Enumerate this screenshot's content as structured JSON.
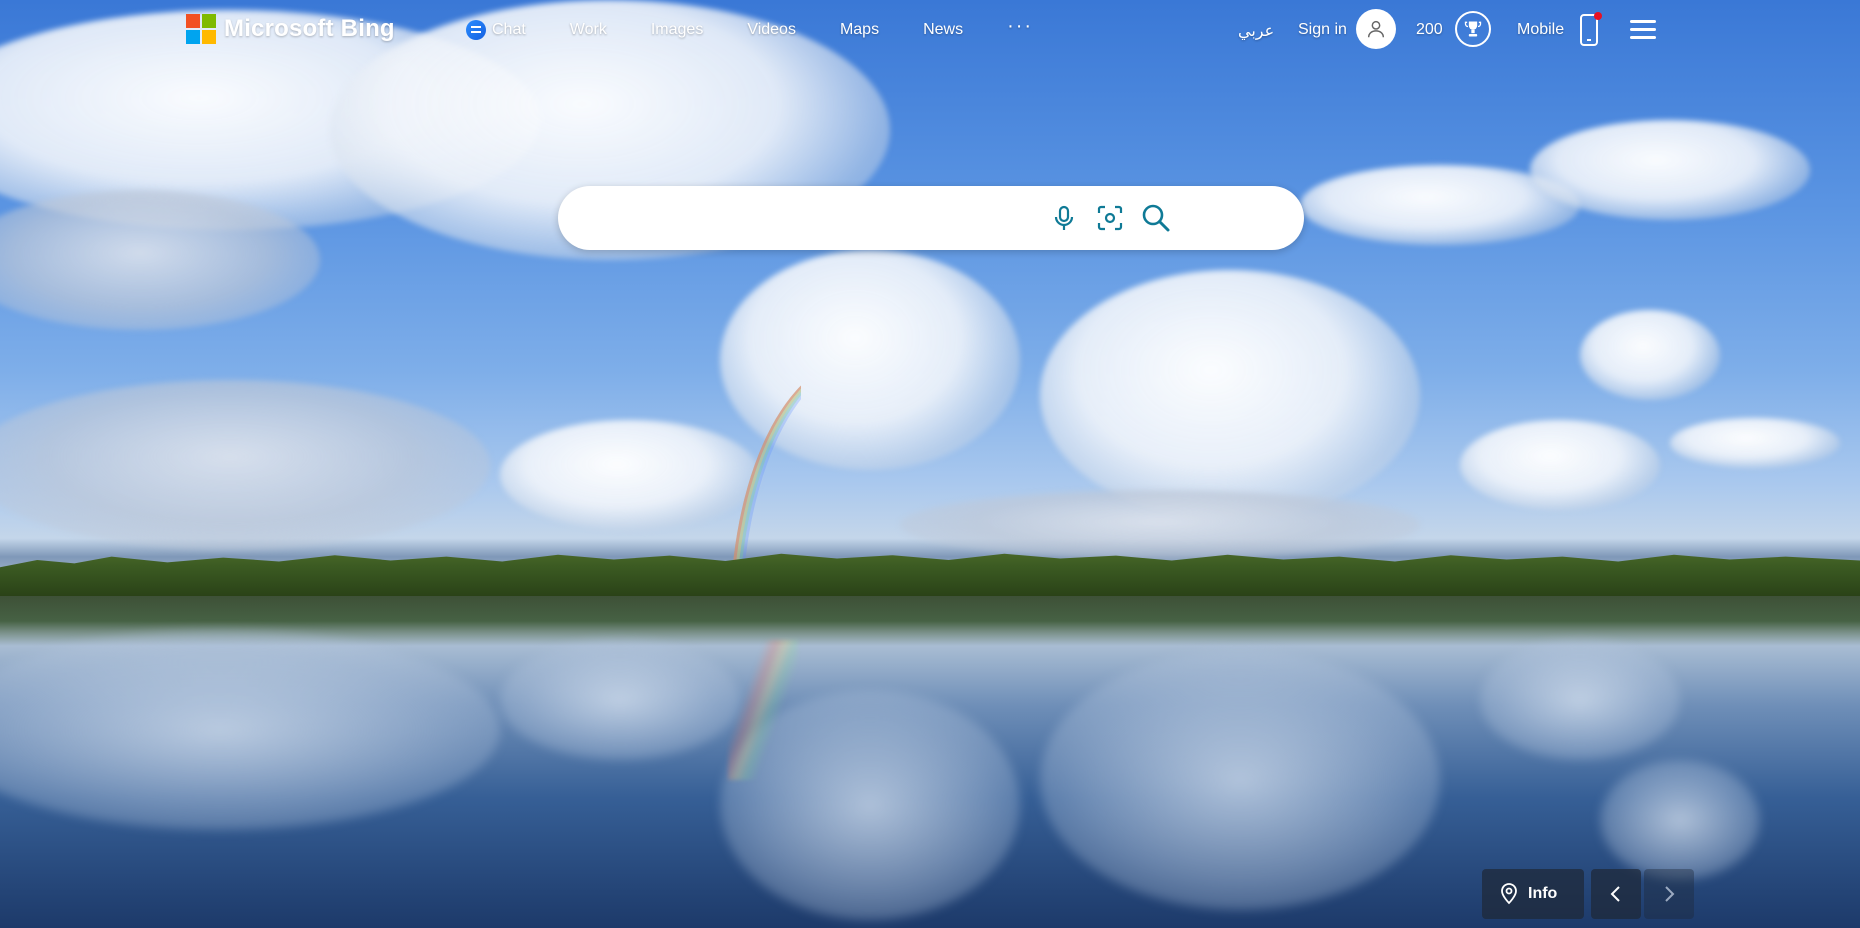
{
  "brand": {
    "name": "Microsoft Bing",
    "logo_colors": [
      "#f25022",
      "#7fba00",
      "#00a4ef",
      "#ffb900"
    ]
  },
  "nav": {
    "items": [
      {
        "label": "Chat",
        "icon": "chat-icon"
      },
      {
        "label": "Work"
      },
      {
        "label": "Images"
      },
      {
        "label": "Videos"
      },
      {
        "label": "Maps"
      },
      {
        "label": "News"
      }
    ],
    "more_label": "···"
  },
  "header_right": {
    "language_link": "عربي",
    "sign_in_label": "Sign in",
    "avatar_icon": "user-icon",
    "rewards_points": "200",
    "rewards_icon": "trophy-icon",
    "mobile_label": "Mobile",
    "mobile_icon": "phone-icon",
    "menu_icon": "hamburger-icon"
  },
  "search": {
    "value": "",
    "placeholder": "",
    "voice_icon": "microphone-icon",
    "visual_search_icon": "camera-icon",
    "submit_icon": "search-icon",
    "accent_color": "#0f7a96"
  },
  "image_controls": {
    "info_label": "Info",
    "info_icon": "location-pin-icon",
    "prev_icon": "chevron-left-icon",
    "next_icon": "chevron-right-icon"
  }
}
